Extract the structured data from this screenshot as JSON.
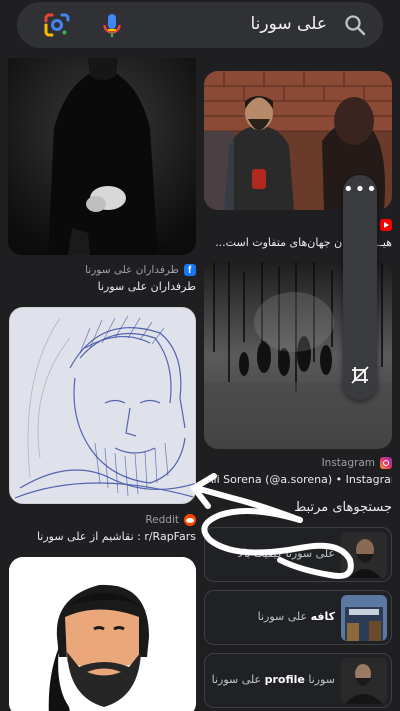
{
  "search": {
    "query": "علی سورنا",
    "icons": {
      "lens": "google-lens-icon",
      "mic": "microphone-icon",
      "search": "search-icon"
    }
  },
  "results": {
    "left": [
      {
        "source": "طرفداران علی سورنا",
        "title": "طرفداران علی سورنا",
        "source_icon": "facebook-icon"
      },
      {
        "source": "Reddit",
        "title": "r/RapFars : نقاشیم از علی سورنا",
        "source_icon": "reddit-icon"
      }
    ],
    "right": [
      {
        "title": "هیـ...گو میان جهان‌های متفاوت است...",
        "source_icon": "youtube-icon"
      },
      {
        "source": "Instagram",
        "title": "Ali Sorena (@a.sorena) • Instagram ...",
        "source_icon": "instagram-icon"
      }
    ]
  },
  "related": {
    "heading": "جستجوهای مرتبط",
    "items": [
      {
        "text": "علی سورنا کیفیت بالا"
      },
      {
        "bold": "کافه",
        "text": "علی سورنا"
      },
      {
        "text": "سورنا",
        "bold": "profile",
        "text2": "علی سورنا"
      }
    ]
  },
  "toolbar": {
    "menu_icon": "more-dots-icon",
    "crop_icon": "crop-off-icon"
  },
  "colors": {
    "background": "#1f1f21",
    "searchbar": "#303134",
    "text": "#e8eaed",
    "muted": "#9aa0a6"
  }
}
